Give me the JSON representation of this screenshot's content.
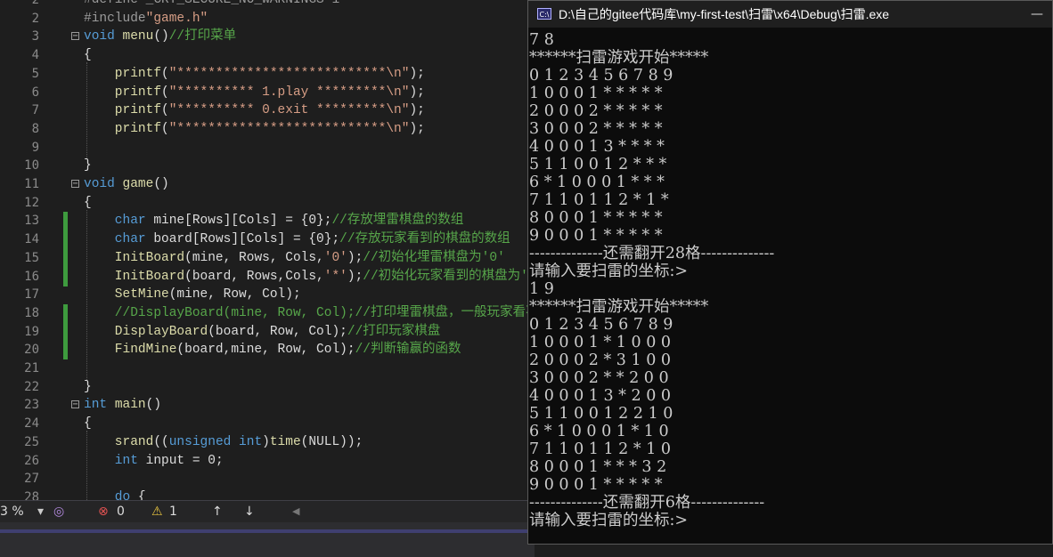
{
  "editor": {
    "lines": [
      {
        "n": "2",
        "tokens": [
          [
            "pp",
            "#define _CRT_SECURE_NO_WARNINGS 1"
          ]
        ]
      },
      {
        "n": "2",
        "tokens": [
          [
            "pp",
            "#include"
          ],
          [
            "str",
            "\"game.h\""
          ]
        ]
      },
      {
        "n": "3",
        "tokens": [
          [
            "kw",
            "void "
          ],
          [
            "fn",
            "menu"
          ],
          [
            "id",
            "()"
          ],
          [
            "cm",
            "//打印菜单"
          ]
        ]
      },
      {
        "n": "4",
        "tokens": [
          [
            "id",
            "{"
          ]
        ]
      },
      {
        "n": "5",
        "tokens": [
          [
            "fn",
            "    printf"
          ],
          [
            "id",
            "("
          ],
          [
            "str",
            "\"***************************\\n\""
          ],
          [
            "id",
            ");"
          ]
        ]
      },
      {
        "n": "6",
        "tokens": [
          [
            "fn",
            "    printf"
          ],
          [
            "id",
            "("
          ],
          [
            "str",
            "\"********** 1.play *********\\n\""
          ],
          [
            "id",
            ");"
          ]
        ]
      },
      {
        "n": "7",
        "tokens": [
          [
            "fn",
            "    printf"
          ],
          [
            "id",
            "("
          ],
          [
            "str",
            "\"********** 0.exit *********\\n\""
          ],
          [
            "id",
            ");"
          ]
        ]
      },
      {
        "n": "8",
        "tokens": [
          [
            "fn",
            "    printf"
          ],
          [
            "id",
            "("
          ],
          [
            "str",
            "\"***************************\\n\""
          ],
          [
            "id",
            ");"
          ]
        ]
      },
      {
        "n": "9",
        "tokens": []
      },
      {
        "n": "10",
        "tokens": [
          [
            "id",
            "}"
          ]
        ]
      },
      {
        "n": "11",
        "tokens": [
          [
            "kw",
            "void "
          ],
          [
            "fn",
            "game"
          ],
          [
            "id",
            "()"
          ]
        ]
      },
      {
        "n": "12",
        "tokens": [
          [
            "id",
            "{"
          ]
        ]
      },
      {
        "n": "13",
        "tokens": [
          [
            "kw",
            "    char "
          ],
          [
            "id",
            "mine[Rows][Cols] = {0};"
          ],
          [
            "cm",
            "//存放埋雷棋盘的数组"
          ]
        ]
      },
      {
        "n": "14",
        "tokens": [
          [
            "kw",
            "    char "
          ],
          [
            "id",
            "board[Rows][Cols] = {0};"
          ],
          [
            "cm",
            "//存放玩家看到的棋盘的数组"
          ]
        ]
      },
      {
        "n": "15",
        "tokens": [
          [
            "fn",
            "    InitBoard"
          ],
          [
            "id",
            "(mine, Rows, Cols,"
          ],
          [
            "str",
            "'0'"
          ],
          [
            "id",
            ");"
          ],
          [
            "cm",
            "//初始化埋雷棋盘为'0'"
          ]
        ]
      },
      {
        "n": "16",
        "tokens": [
          [
            "fn",
            "    InitBoard"
          ],
          [
            "id",
            "(board, Rows,Cols,"
          ],
          [
            "str",
            "'*'"
          ],
          [
            "id",
            ");"
          ],
          [
            "cm",
            "//初始化玩家看到的棋盘为'*'"
          ]
        ]
      },
      {
        "n": "17",
        "tokens": [
          [
            "fn",
            "    SetMine"
          ],
          [
            "id",
            "(mine, Row, Col);"
          ]
        ]
      },
      {
        "n": "18",
        "tokens": [
          [
            "cm",
            "    //DisplayBoard(mine, Row, Col);//打印埋雷棋盘，一般玩家看不到"
          ]
        ]
      },
      {
        "n": "19",
        "tokens": [
          [
            "fn",
            "    DisplayBoard"
          ],
          [
            "id",
            "(board, Row, Col);"
          ],
          [
            "cm",
            "//打印玩家棋盘"
          ]
        ]
      },
      {
        "n": "20",
        "tokens": [
          [
            "fn",
            "    FindMine"
          ],
          [
            "id",
            "(board,mine, Row, Col);"
          ],
          [
            "cm",
            "//判断输赢的函数"
          ]
        ]
      },
      {
        "n": "21",
        "tokens": []
      },
      {
        "n": "22",
        "tokens": [
          [
            "id",
            "}"
          ]
        ]
      },
      {
        "n": "23",
        "tokens": [
          [
            "kw",
            "int "
          ],
          [
            "fn",
            "main"
          ],
          [
            "id",
            "()"
          ]
        ]
      },
      {
        "n": "24",
        "tokens": [
          [
            "id",
            "{"
          ]
        ]
      },
      {
        "n": "25",
        "tokens": [
          [
            "fn",
            "    srand"
          ],
          [
            "id",
            "(("
          ],
          [
            "kw",
            "unsigned int"
          ],
          [
            "id",
            ")"
          ],
          [
            "fn",
            "time"
          ],
          [
            "id",
            "(NULL));"
          ]
        ]
      },
      {
        "n": "26",
        "tokens": [
          [
            "kw",
            "    int "
          ],
          [
            "id",
            "input = 0;"
          ]
        ]
      },
      {
        "n": "27",
        "tokens": []
      },
      {
        "n": "28",
        "tokens": [
          [
            "kw",
            "    do "
          ],
          [
            "id",
            "{"
          ]
        ]
      }
    ]
  },
  "status": {
    "zoom": "3 %",
    "errors": "0",
    "warnings": "1"
  },
  "console": {
    "title": "D:\\自己的gitee代码库\\my-first-test\\扫雷\\x64\\Debug\\扫雷.exe",
    "icon_text": "C:\\",
    "minimize": "—",
    "lines": [
      "7 8",
      "******扫雷游戏开始*****",
      "0 1 2 3 4 5 6 7 8 9",
      "1 0 0 0 1 * * * * *",
      "2 0 0 0 2 * * * * *",
      "3 0 0 0 2 * * * * *",
      "4 0 0 0 1 3 * * * *",
      "5 1 1 0 0 1 2 * * *",
      "6 * 1 0 0 0 1 * * *",
      "7 1 1 0 1 1 2 * 1 *",
      "8 0 0 0 1 * * * * *",
      "9 0 0 0 1 * * * * *",
      "--------------还需翻开28格--------------",
      "请输入要扫雷的坐标:>",
      "1 9",
      "******扫雷游戏开始*****",
      "0 1 2 3 4 5 6 7 8 9",
      "1 0 0 0 1 * 1 0 0 0",
      "2 0 0 0 2 * 3 1 0 0",
      "3 0 0 0 2 * * 2 0 0",
      "4 0 0 0 1 3 * 2 0 0",
      "5 1 1 0 0 1 2 2 1 0",
      "6 * 1 0 0 0 1 * 1 0",
      "7 1 1 0 1 1 2 * 1 0",
      "8 0 0 0 1 * * * 3 2",
      "9 0 0 0 1 * * * * *",
      "--------------还需翻开6格--------------",
      "请输入要扫雷的坐标:>"
    ]
  }
}
